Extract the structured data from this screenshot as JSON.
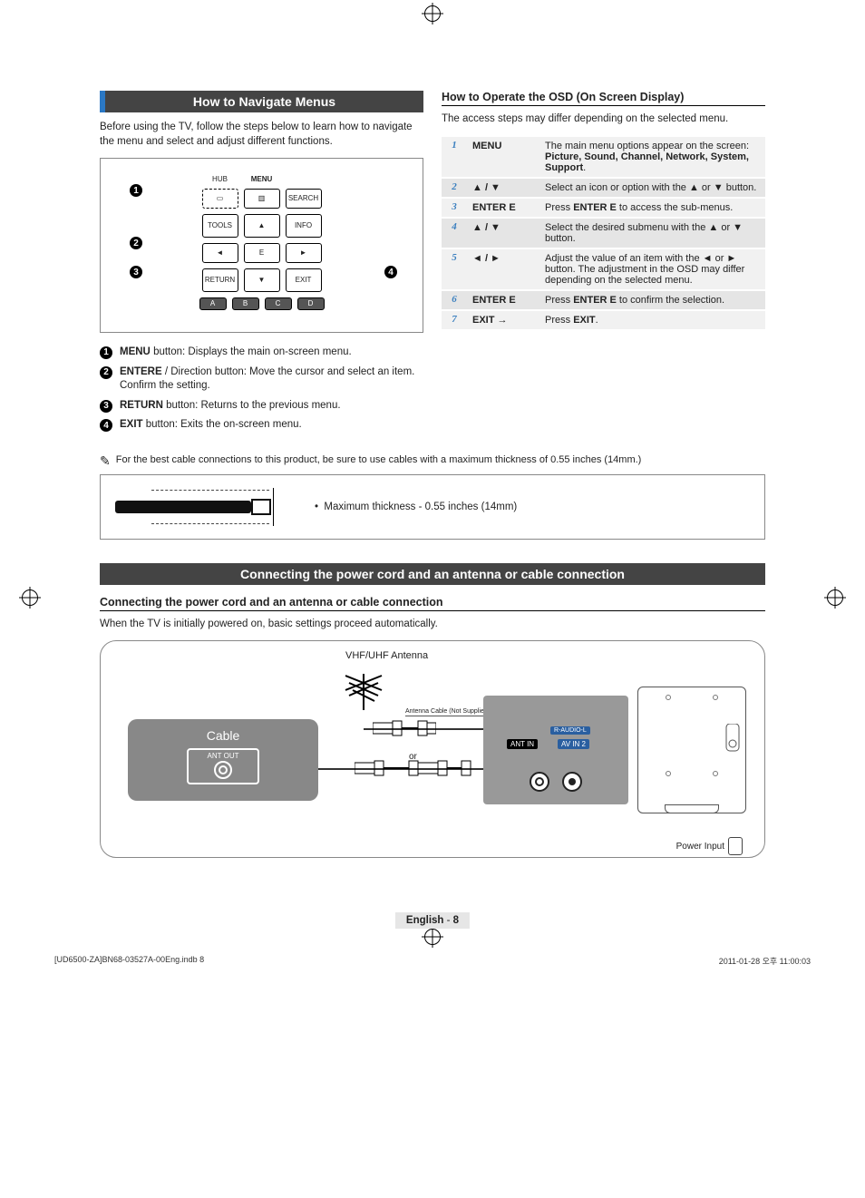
{
  "sections": {
    "navigate_title": "How to Navigate Menus",
    "navigate_intro": "Before using the TV, follow the steps below to learn how to navigate the menu and select and adjust different functions.",
    "connect_title": "Connecting the power cord and an antenna or cable connection",
    "connect_subhead": "Connecting the power cord and an antenna or cable connection",
    "connect_intro": "When the TV is initially powered on, basic settings proceed automatically."
  },
  "remote": {
    "hub": "HUB",
    "menu": "MENU",
    "search": "SEARCH",
    "tools": "TOOLS",
    "info": "INFO",
    "return": "RETURN",
    "exit": "EXIT",
    "enter_glyph": "E",
    "color_a": "A",
    "color_b": "B",
    "color_c": "C",
    "color_d": "D"
  },
  "remote_leads": {
    "l1": "1",
    "l2": "2",
    "l3": "3",
    "l4": "4"
  },
  "button_descriptions": [
    {
      "n": "1",
      "bold": "MENU",
      "rest": " button: Displays the main on-screen menu."
    },
    {
      "n": "2",
      "bold": "ENTER",
      "glyph": "E",
      "rest": " / Direction button: Move the cursor and select an item. Confirm the setting."
    },
    {
      "n": "3",
      "bold": "RETURN",
      "rest": " button: Returns to the previous menu."
    },
    {
      "n": "4",
      "bold": "EXIT",
      "rest": " button: Exits the on-screen menu."
    }
  ],
  "osd": {
    "heading": "How to Operate the OSD (On Screen Display)",
    "intro": "The access steps may differ depending on the selected menu.",
    "steps": [
      {
        "n": "1",
        "label": "MENU",
        "desc_pre": "The main menu options appear on the screen:",
        "desc_bold": "Picture, Sound, Channel, Network, System, Support",
        "desc_post": "."
      },
      {
        "n": "2",
        "label": "▲ / ▼",
        "desc_pre": "Select an icon or option with the ▲ or ▼ button."
      },
      {
        "n": "3",
        "label": "ENTER E",
        "desc_pre": "Press ",
        "desc_bold": "ENTER E",
        "desc_post": " to access the sub-menus."
      },
      {
        "n": "4",
        "label": "▲ / ▼",
        "desc_pre": "Select the desired submenu with the ▲ or ▼ button."
      },
      {
        "n": "5",
        "label": "◄ / ►",
        "desc_pre": "Adjust the value of an item with the ◄ or ► button. The adjustment in the OSD may differ depending on the selected menu."
      },
      {
        "n": "6",
        "label": "ENTER E",
        "desc_pre": "Press ",
        "desc_bold": "ENTER E",
        "desc_post": " to confirm the selection."
      },
      {
        "n": "7",
        "label": "EXIT →",
        "desc_pre": "Press ",
        "desc_bold": "EXIT",
        "desc_post": "."
      }
    ]
  },
  "cable_note": "For the best cable connections to this product, be sure to use cables with a maximum thickness of 0.55 inches (14mm.)",
  "cable_tip_bullet": "Maximum thickness - 0.55 inches (14mm)",
  "diagram": {
    "antenna_label": "VHF/UHF Antenna",
    "cable_box": "Cable",
    "ant_out": "ANT OUT",
    "ant_in": "ANT IN",
    "avin": "AV IN 2",
    "audio": "R-AUDIO-L",
    "or": "or",
    "cable_supplied": "Antenna Cable (Not Supplied)",
    "power_input": "Power Input"
  },
  "footer": {
    "lang": "English",
    "sep": " - ",
    "page": "8"
  },
  "meta": {
    "left": "[UD6500-ZA]BN68-03527A-00Eng.indb   8",
    "right": "2011-01-28   오후 11:00:03"
  }
}
